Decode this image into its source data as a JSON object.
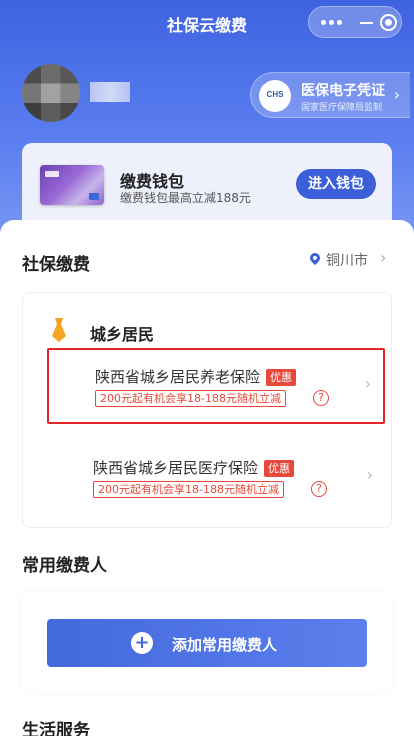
{
  "title_bar": {
    "title": "社保云缴费"
  },
  "user": {
    "cert_logo_text": "CHS",
    "cert_title": "医保电子凭证",
    "cert_subtitle": "国家医疗保障局监制"
  },
  "wallet": {
    "title": "缴费钱包",
    "description": "缴费钱包最高立减188元",
    "button": "进入钱包"
  },
  "social_pay": {
    "section_title": "社保缴费",
    "location": "铜川市",
    "category": "城乡居民",
    "items": [
      {
        "name": "陕西省城乡居民养老保险",
        "badge": "优惠",
        "promo": "200元起有机会享18-188元随机立减",
        "help": "?"
      },
      {
        "name": "陕西省城乡居民医疗保险",
        "badge": "优惠",
        "promo": "200元起有机会享18-188元随机立减",
        "help": "?"
      }
    ]
  },
  "payers": {
    "section_title": "常用缴费人",
    "add_button": "添加常用缴费人",
    "add_icon": "+"
  },
  "life_services": {
    "section_title": "生活服务"
  },
  "colors": {
    "brand_blue": "#3a5fd8",
    "promo_red": "#e8483c",
    "highlight_red": "#e3232a"
  }
}
